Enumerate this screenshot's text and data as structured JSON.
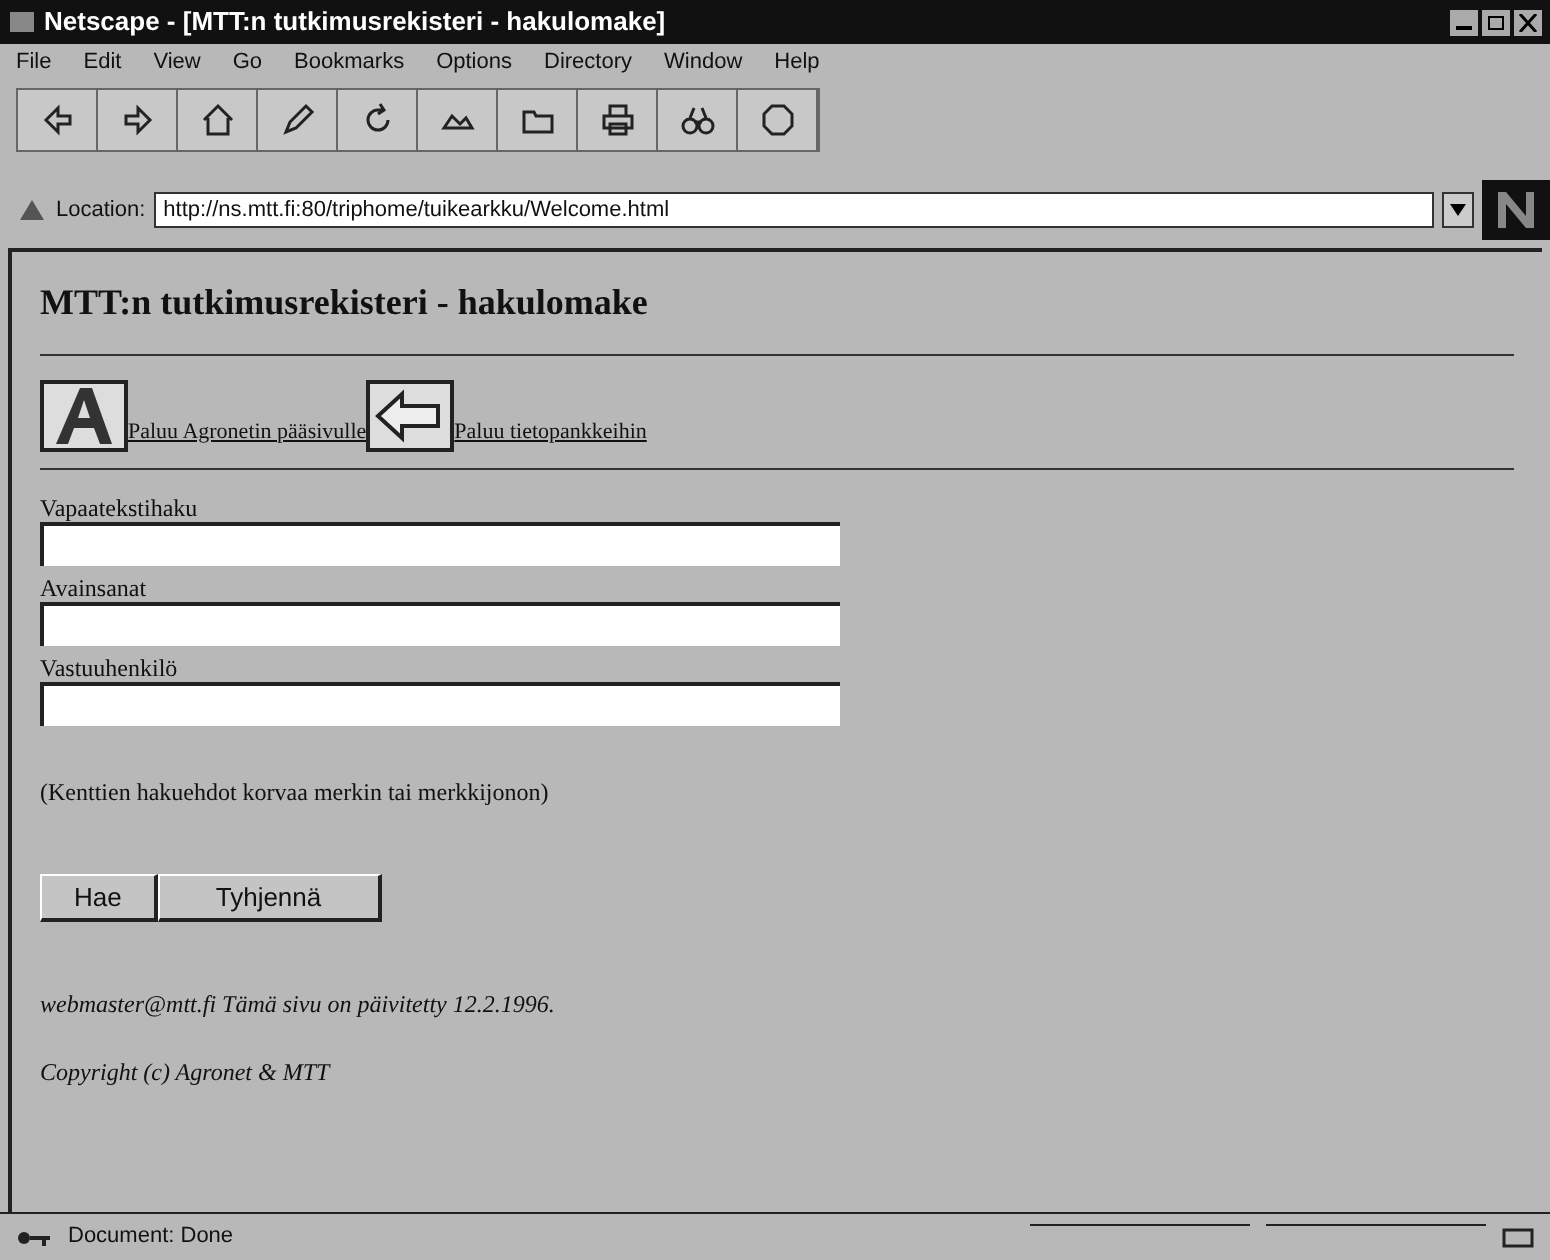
{
  "window": {
    "title": "Netscape - [MTT:n tutkimusrekisteri - hakulomake]"
  },
  "menu": [
    "File",
    "Edit",
    "View",
    "Go",
    "Bookmarks",
    "Options",
    "Directory",
    "Window",
    "Help"
  ],
  "toolbar": [
    {
      "kind": "back"
    },
    {
      "kind": "forward"
    },
    {
      "kind": "home"
    },
    {
      "kind": "edit"
    },
    {
      "kind": "reload"
    },
    {
      "kind": "images"
    },
    {
      "kind": "open"
    },
    {
      "kind": "print"
    },
    {
      "kind": "find"
    },
    {
      "kind": "stop"
    }
  ],
  "location": {
    "label": "Location:",
    "value": "http://ns.mtt.fi:80/triphome/tuikearkku/Welcome.html"
  },
  "page": {
    "heading": "MTT:n tutkimusrekisteri - hakulomake",
    "links": [
      {
        "kind": "agronet",
        "text": "Paluu Agronetin pääsivulle"
      },
      {
        "kind": "back",
        "text": "Paluu tietopankkeihin"
      }
    ],
    "fields": [
      {
        "label": "Vapaatekstihaku"
      },
      {
        "label": "Avainsanat"
      },
      {
        "label": "Vastuuhenkilö"
      }
    ],
    "note": "(Kenttien hakuehdot korvaa merkin tai merkkijonon)",
    "buttons": [
      "Hae",
      "Tyhjennä"
    ],
    "footer": [
      "webmaster@mtt.fi Tämä sivu on päivitetty 12.2.1996.",
      "Copyright (c) Agronet & MTT"
    ]
  },
  "status_bar": {
    "text": "Document: Done"
  }
}
